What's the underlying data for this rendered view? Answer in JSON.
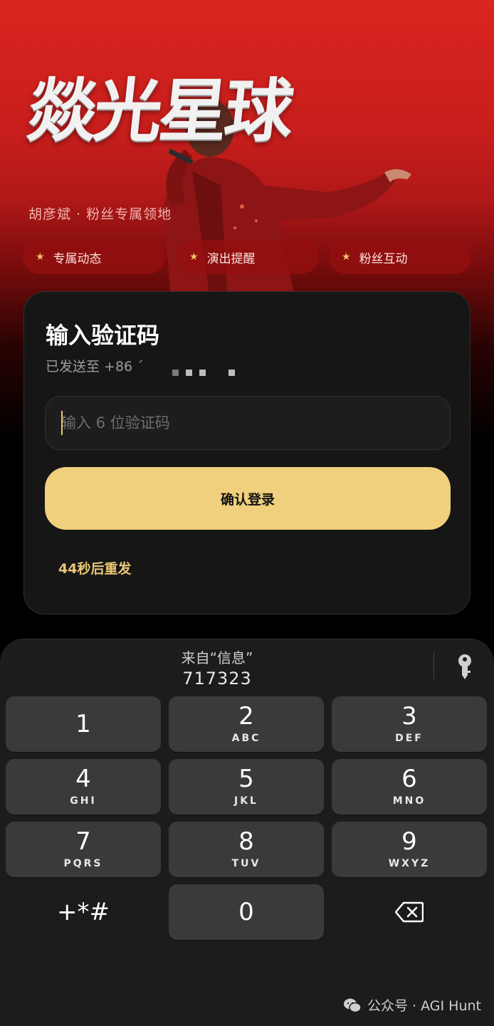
{
  "hero": {
    "title": "燚光星球",
    "subtitle": "胡彦斌 · 粉丝专属领地",
    "pills": [
      {
        "label": "专属动态"
      },
      {
        "label": "演出提醒"
      },
      {
        "label": "粉丝互动"
      }
    ]
  },
  "card": {
    "heading": "输入验证码",
    "sent_to": "已发送至 +86 ´",
    "input_placeholder": "输入 6 位验证码",
    "input_value": "",
    "confirm_label": "确认登录",
    "resend_label": "44秒后重发"
  },
  "keyboard": {
    "suggestion_source": "来自“信息”",
    "suggestion_code": "717323",
    "keys": [
      {
        "num": "1",
        "letters": ""
      },
      {
        "num": "2",
        "letters": "ABC"
      },
      {
        "num": "3",
        "letters": "DEF"
      },
      {
        "num": "4",
        "letters": "GHI"
      },
      {
        "num": "5",
        "letters": "JKL"
      },
      {
        "num": "6",
        "letters": "MNO"
      },
      {
        "num": "7",
        "letters": "PQRS"
      },
      {
        "num": "8",
        "letters": "TUV"
      },
      {
        "num": "9",
        "letters": "WXYZ"
      },
      {
        "num": "+*#",
        "letters": ""
      },
      {
        "num": "0",
        "letters": ""
      }
    ]
  },
  "watermark": "公众号 · AGI Hunt",
  "colors": {
    "accent": "#f0d07c",
    "hero_red": "#d9251f",
    "card_bg": "#161616",
    "key_bg": "#3a3a3a"
  }
}
